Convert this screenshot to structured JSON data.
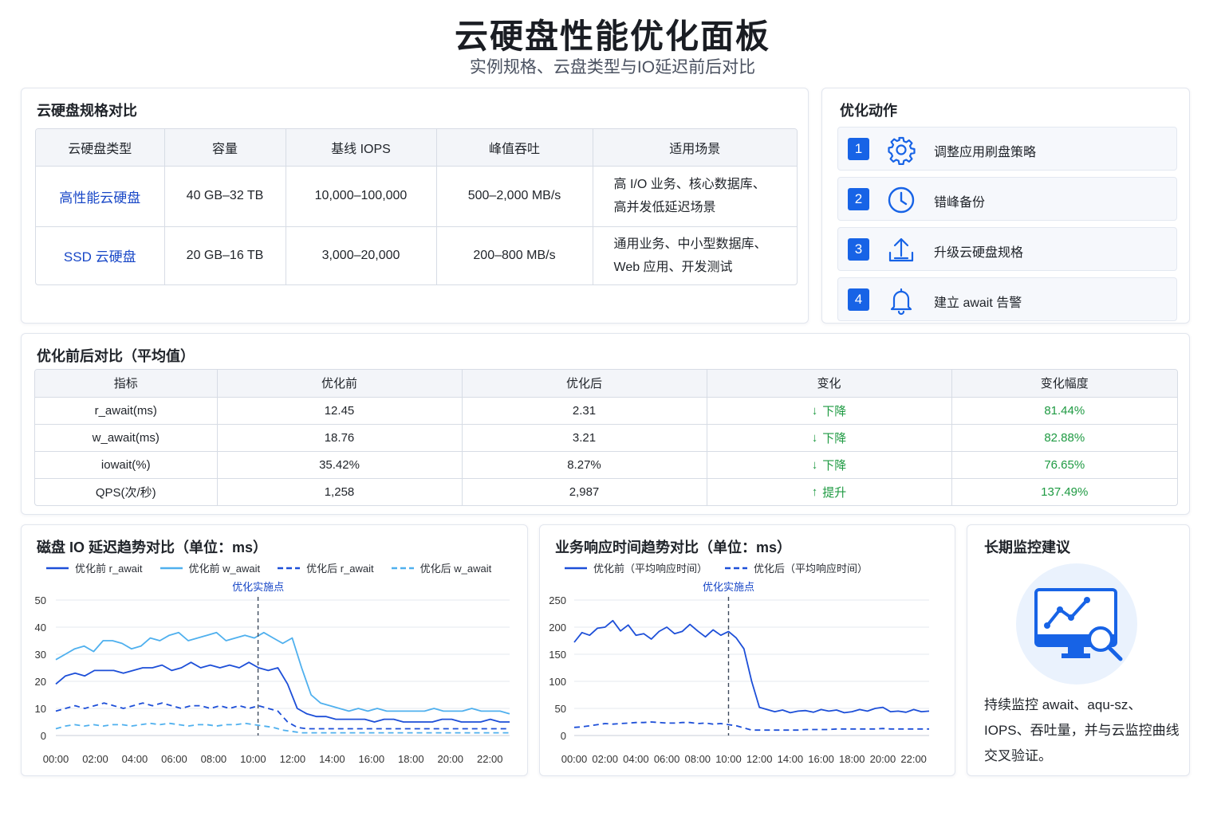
{
  "header": {
    "title": "云硬盘性能优化面板",
    "subtitle": "实例规格、云盘类型与IO延迟前后对比"
  },
  "spec": {
    "title": "云硬盘规格对比",
    "columns": [
      "云硬盘类型",
      "容量",
      "基线 IOPS",
      "峰值吞吐",
      "适用场景"
    ],
    "rows": [
      {
        "type": "高性能云硬盘",
        "capacity": "40 GB–32 TB",
        "iops": "10,000–100,000",
        "throughput": "500–2,000 MB/s",
        "scene_lines": [
          "高 I/O 业务、核心数据库、",
          "高并发低延迟场景"
        ]
      },
      {
        "type": "SSD 云硬盘",
        "capacity": "20 GB–16 TB",
        "iops": "3,000–20,000",
        "throughput": "200–800 MB/s",
        "scene_lines": [
          "通用业务、中小型数据库、",
          "Web 应用、开发测试"
        ]
      }
    ]
  },
  "actions": {
    "title": "优化动作",
    "items": [
      {
        "num": "1",
        "icon": "gear-icon",
        "label": "调整应用刷盘策略"
      },
      {
        "num": "2",
        "icon": "clock-icon",
        "label": "错峰备份"
      },
      {
        "num": "3",
        "icon": "upload-icon",
        "label": "升级云硬盘规格"
      },
      {
        "num": "4",
        "icon": "bell-icon",
        "label": "建立 await 告警"
      }
    ]
  },
  "compare": {
    "title": "优化前后对比（平均值）",
    "columns": [
      "指标",
      "优化前",
      "优化后",
      "变化",
      "变化幅度"
    ],
    "rows": [
      {
        "metric": "r_await(ms)",
        "before": "12.45",
        "after": "2.31",
        "arrow": "↓",
        "change": "下降",
        "pct": "81.44%"
      },
      {
        "metric": "w_await(ms)",
        "before": "18.76",
        "after": "3.21",
        "arrow": "↓",
        "change": "下降",
        "pct": "82.88%"
      },
      {
        "metric": "iowait(%)",
        "before": "35.42%",
        "after": "8.27%",
        "arrow": "↓",
        "change": "下降",
        "pct": "76.65%"
      },
      {
        "metric": "QPS(次/秒)",
        "before": "1,258",
        "after": "2,987",
        "arrow": "↑",
        "change": "提升",
        "pct": "137.49%"
      }
    ],
    "change_color": "#1e9a42"
  },
  "chart1": {
    "title": "磁盘 IO 延迟趋势对比（单位：ms）",
    "annotation": "优化实施点",
    "chart_data": {
      "type": "line",
      "ylim": [
        0,
        50
      ],
      "yticks": [
        "0",
        "10",
        "20",
        "30",
        "40",
        "50"
      ],
      "xticks": [
        "00:00",
        "02:00",
        "04:00",
        "06:00",
        "08:00",
        "10:00",
        "12:00",
        "14:00",
        "16:00",
        "18:00",
        "20:00",
        "22:00"
      ],
      "x_range_hours": [
        0,
        23
      ],
      "marker_hour": 10.25,
      "series": [
        {
          "name": "优化前 r_await",
          "color": "#1d4fd8",
          "dash": false,
          "hours_from": 0,
          "values": [
            19,
            22,
            23,
            22,
            24,
            24,
            24,
            23,
            24,
            25,
            25,
            26,
            24,
            25,
            27,
            25,
            26,
            25,
            26,
            25,
            27,
            25,
            24,
            25,
            19,
            10,
            8,
            7,
            7,
            6,
            6,
            6,
            6,
            5,
            6,
            6,
            5,
            5,
            5,
            5,
            6,
            6,
            5,
            5,
            5,
            6,
            5,
            5
          ]
        },
        {
          "name": "优化前 w_await",
          "color": "#4fb0ee",
          "dash": false,
          "hours_from": 0,
          "values": [
            28,
            30,
            32,
            33,
            31,
            35,
            35,
            34,
            32,
            33,
            36,
            35,
            37,
            38,
            35,
            36,
            37,
            38,
            35,
            36,
            37,
            36,
            38,
            36,
            34,
            36,
            25,
            15,
            12,
            11,
            10,
            9,
            10,
            9,
            10,
            9,
            9,
            9,
            9,
            9,
            10,
            9,
            9,
            9,
            10,
            9,
            9,
            9,
            8
          ]
        },
        {
          "name": "优化后 r_await",
          "color": "#1d4fd8",
          "dash": true,
          "hours_from": 0,
          "values": [
            9,
            10,
            11,
            10,
            11,
            12,
            11,
            10,
            11,
            12,
            11,
            12,
            11,
            10,
            11,
            11,
            10,
            11,
            10,
            11,
            10,
            11,
            10,
            9,
            5,
            3,
            2.5,
            2.5,
            2.5,
            2.5,
            2.5,
            2.5,
            2.5,
            2.5,
            2.5,
            2.5,
            2.5,
            2.5,
            2.5,
            2.5,
            2.5,
            2.5,
            2.5,
            2.5,
            2.5,
            2.5,
            2.5,
            2.5
          ]
        },
        {
          "name": "优化后 w_await",
          "color": "#4fb0ee",
          "dash": true,
          "hours_from": 0,
          "values": [
            2.5,
            3.5,
            4,
            3.5,
            4,
            3.5,
            4,
            4,
            3.5,
            4,
            4.5,
            4,
            4.5,
            4,
            3.5,
            4,
            4,
            3.5,
            4,
            4,
            4.5,
            4,
            3.5,
            3,
            2,
            1.5,
            1,
            1,
            1,
            1,
            1,
            1,
            1,
            1,
            1,
            1,
            1,
            1,
            1,
            1,
            1,
            1,
            1,
            1,
            1,
            1,
            1,
            1,
            1
          ]
        }
      ]
    }
  },
  "chart2": {
    "title": "业务响应时间趋势对比（单位：ms）",
    "annotation": "优化实施点",
    "chart_data": {
      "type": "line",
      "ylim": [
        0,
        250
      ],
      "yticks": [
        "0",
        "50",
        "100",
        "150",
        "200",
        "250"
      ],
      "xticks": [
        "00:00",
        "02:00",
        "04:00",
        "06:00",
        "08:00",
        "10:00",
        "12:00",
        "14:00",
        "16:00",
        "18:00",
        "20:00",
        "22:00"
      ],
      "x_range_hours": [
        0,
        23
      ],
      "marker_hour": 10.0,
      "series": [
        {
          "name": "优化前（平均响应时间）",
          "color": "#1d4fd8",
          "dash": false,
          "values": [
            172,
            190,
            185,
            198,
            200,
            212,
            193,
            204,
            185,
            188,
            178,
            192,
            200,
            188,
            192,
            205,
            193,
            182,
            195,
            185,
            192,
            180,
            160,
            100,
            52,
            48,
            44,
            47,
            42,
            45,
            46,
            43,
            48,
            45,
            47,
            42,
            44,
            48,
            45,
            50,
            52,
            44,
            45,
            43,
            48,
            44,
            45
          ]
        },
        {
          "name": "优化后（平均响应时间）",
          "color": "#1d4fd8",
          "dash": true,
          "values": [
            15,
            16,
            18,
            20,
            22,
            21,
            22,
            23,
            24,
            24,
            25,
            24,
            23,
            23,
            24,
            24,
            22,
            23,
            21,
            22,
            20,
            18,
            14,
            10,
            10,
            10,
            10,
            10,
            10,
            10,
            11,
            11,
            11,
            11,
            12,
            12,
            12,
            12,
            12,
            12,
            13,
            12,
            12,
            12,
            12,
            12,
            12
          ]
        }
      ]
    }
  },
  "monitor": {
    "title": "长期监控建议",
    "icon": "monitor-analytics-icon",
    "text": "持续监控 await、aqu-sz、IOPS、吞吐量，并与云监控曲线交叉验证。"
  }
}
